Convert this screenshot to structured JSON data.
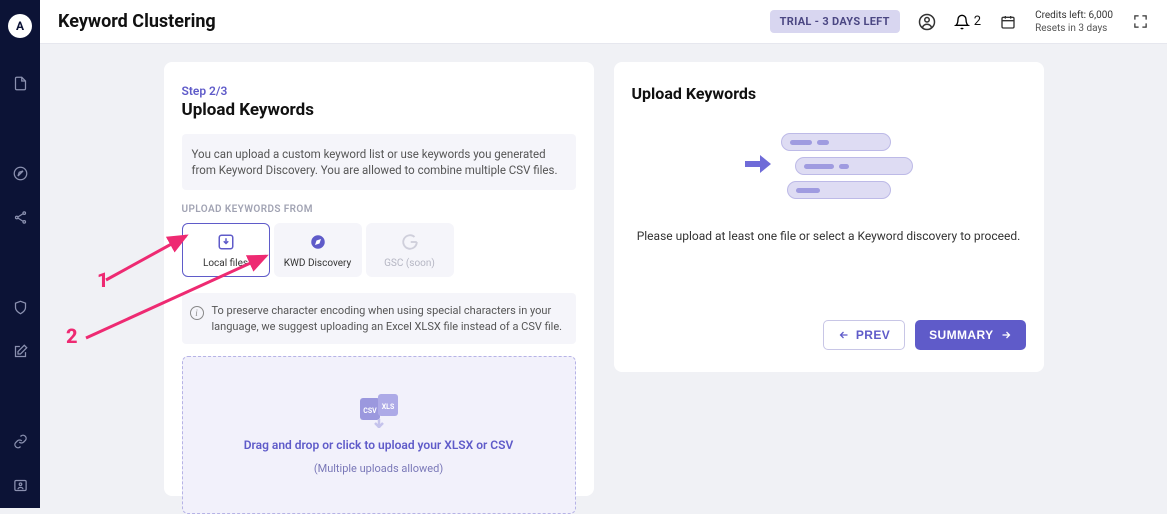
{
  "header": {
    "title": "Keyword Clustering",
    "trial_badge": "TRIAL - 3 DAYS LEFT",
    "notif_count": "2",
    "credits_line1": "Credits left: 6,000",
    "credits_line2": "Resets in 3 days"
  },
  "left": {
    "step": "Step 2/3",
    "title": "Upload Keywords",
    "description": "You can upload a custom keyword list or use keywords you generated from Keyword Discovery. You are allowed to combine multiple CSV files.",
    "section_label": "UPLOAD KEYWORDS FROM",
    "sources": {
      "local": "Local files",
      "kwd": "KWD Discovery",
      "gsc": "GSC (soon)"
    },
    "info": "To preserve character encoding when using special characters in your language, we suggest uploading an Excel XLSX file instead of a CSV file.",
    "dropzone": {
      "csv_label": "CSV",
      "xls_label": "XLS",
      "text": "Drag and drop or click to upload your XLSX or CSV",
      "sub": "(Multiple uploads allowed)"
    }
  },
  "right": {
    "title": "Upload Keywords",
    "message": "Please upload at least one file or select a Keyword discovery to proceed.",
    "prev": "PREV",
    "summary": "SUMMARY"
  },
  "annotations": {
    "n1": "1",
    "n2": "2"
  }
}
